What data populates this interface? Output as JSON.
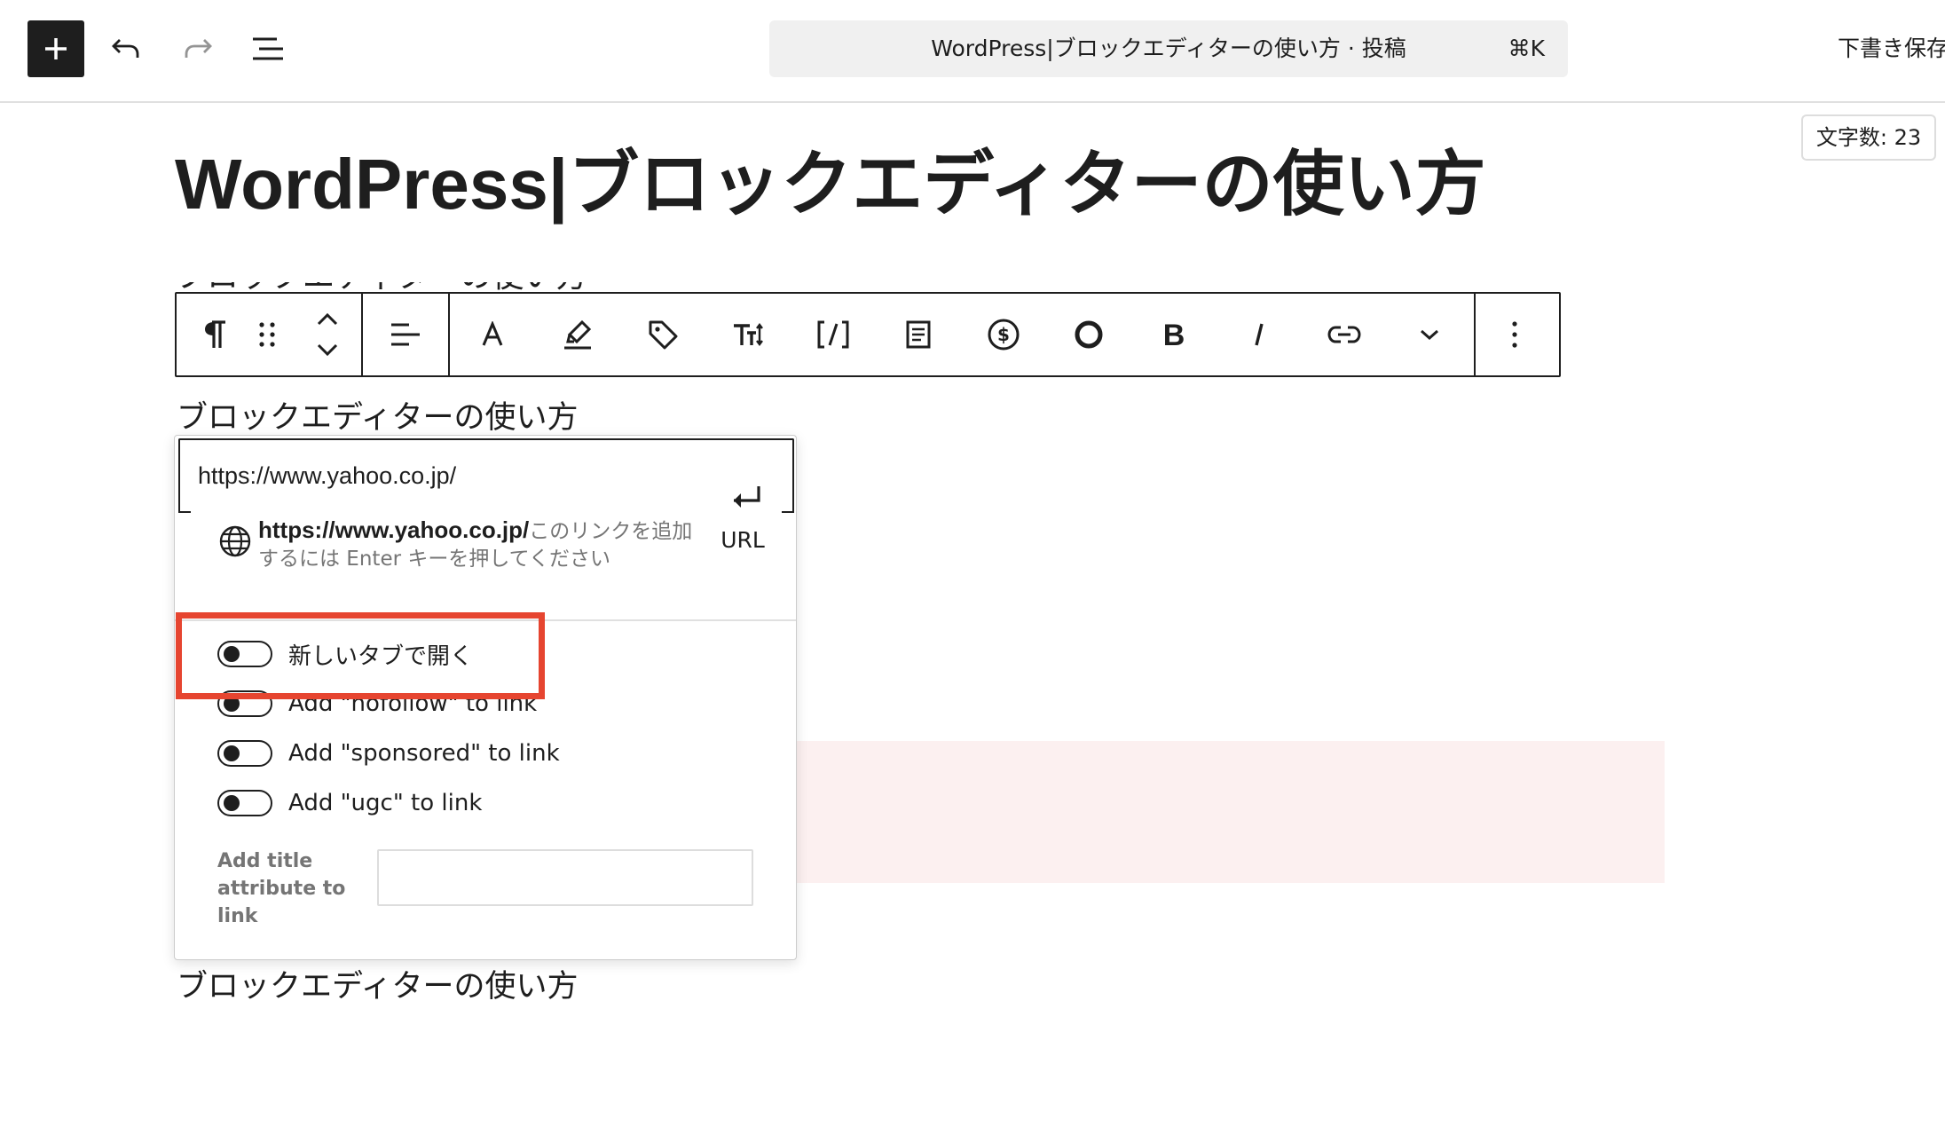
{
  "header": {
    "document_title": "WordPress|ブロックエディターの使い方 · 投稿",
    "command_shortcut": "⌘K",
    "save_draft_label": "下書き保存",
    "icons": [
      "plus-icon",
      "undo-icon",
      "redo-icon",
      "list-view-icon"
    ]
  },
  "word_count": "文字数: 23",
  "post": {
    "title": "WordPress|ブロックエディターの使い方",
    "paragraph_text": "ブロックエディターの使い方"
  },
  "block_toolbar": {
    "icons": [
      "paragraph-icon",
      "drag-handle-icon",
      "move-up-icon",
      "move-down-icon",
      "align-icon",
      "text-color-icon",
      "highlight-icon",
      "tag-icon",
      "font-size-icon",
      "shortcode-icon",
      "excerpt-icon",
      "dollar-icon",
      "circle-icon",
      "bold-icon",
      "italic-icon",
      "link-icon",
      "chevron-down-icon",
      "more-options-icon"
    ]
  },
  "link_popover": {
    "url_value": "https://www.yahoo.co.jp/",
    "suggestion_url": "https://www.yahoo.co.jp/",
    "suggestion_hint": "このリンクを追加するには Enter キーを押してください",
    "submit_label": "URL",
    "toggles": [
      {
        "label": "新しいタブで開く",
        "checked": false
      },
      {
        "label": "Add \"nofollow\" to link",
        "checked": false
      },
      {
        "label": "Add \"sponsored\" to link",
        "checked": false
      },
      {
        "label": "Add \"ugc\" to link",
        "checked": false
      }
    ],
    "title_attribute_label": "Add title attribute to link",
    "title_attribute_value": ""
  },
  "colors": {
    "dark": "#1e1e1e",
    "highlight_border": "#e64530",
    "pink_block": "#fcf0f0",
    "muted_text": "#757575"
  }
}
